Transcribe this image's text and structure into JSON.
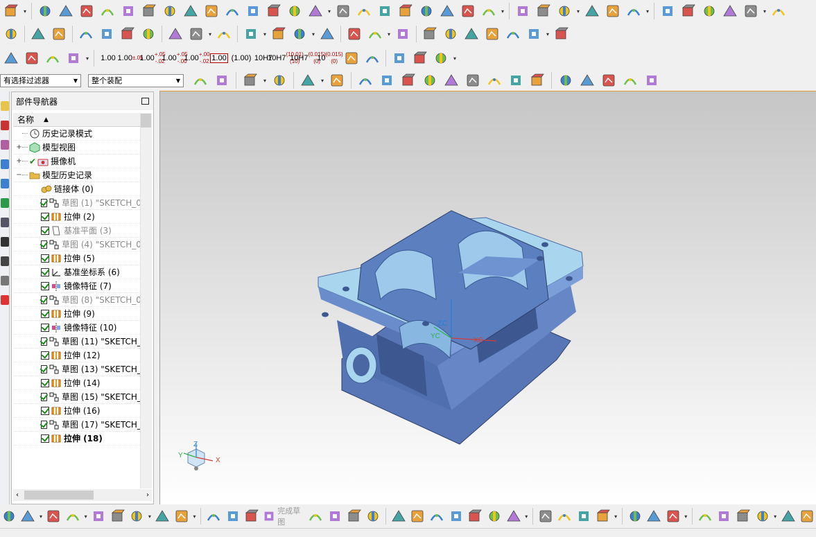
{
  "filter": {
    "selection_filter": "有选择过滤器",
    "scope": "整个装配"
  },
  "tolerance_buttons": [
    {
      "main": "1.00",
      "sub": ""
    },
    {
      "main": "1.00",
      "sub": "±.05"
    },
    {
      "main": "1.00",
      "sub": "+.05 -.02"
    },
    {
      "main": "1.00",
      "sub": "+.05 -.00"
    },
    {
      "main": "1.00",
      "sub": "+.00 -.02"
    },
    {
      "main": "1.00",
      "sub": "boxed"
    },
    {
      "main": "(1.00)",
      "sub": ""
    },
    {
      "main": "10H7",
      "sub": ""
    },
    {
      "main": "10H7",
      "sub": "(10.01) (10)"
    },
    {
      "main": "10H7",
      "sub": "(0.015) (0)"
    },
    {
      "main": "10",
      "sub": "(0.015) (0)"
    }
  ],
  "toolbar2_label": "10H7",
  "navigator": {
    "title": "部件导航器",
    "column_name": "名称",
    "items": [
      {
        "label": "历史记录模式",
        "depth": 0,
        "expander": "",
        "check": "none",
        "icon": "clock-icon",
        "style": ""
      },
      {
        "label": "模型视图",
        "depth": 0,
        "expander": "+",
        "check": "none",
        "icon": "model-view-icon",
        "style": ""
      },
      {
        "label": "摄像机",
        "depth": 0,
        "expander": "+",
        "check": "tick",
        "icon": "camera-icon",
        "style": ""
      },
      {
        "label": "模型历史记录",
        "depth": 0,
        "expander": "−",
        "check": "none",
        "icon": "folder-icon",
        "style": ""
      },
      {
        "label": "链接体 (0)",
        "depth": 1,
        "expander": "",
        "check": "none",
        "icon": "linked-body-icon",
        "style": ""
      },
      {
        "label": "草图 (1) \"SKETCH_0...",
        "depth": 1,
        "expander": "",
        "check": "on",
        "icon": "sketch-icon",
        "style": "grey"
      },
      {
        "label": "拉伸 (2)",
        "depth": 1,
        "expander": "",
        "check": "on",
        "icon": "extrude-icon",
        "style": ""
      },
      {
        "label": "基准平面 (3)",
        "depth": 1,
        "expander": "",
        "check": "on",
        "icon": "datum-plane-icon",
        "style": "grey"
      },
      {
        "label": "草图 (4) \"SKETCH_0...",
        "depth": 1,
        "expander": "",
        "check": "on",
        "icon": "sketch-icon",
        "style": "grey"
      },
      {
        "label": "拉伸 (5)",
        "depth": 1,
        "expander": "",
        "check": "on",
        "icon": "extrude-icon",
        "style": ""
      },
      {
        "label": "基准坐标系 (6)",
        "depth": 1,
        "expander": "",
        "check": "on",
        "icon": "datum-csys-icon",
        "style": ""
      },
      {
        "label": "镜像特征 (7)",
        "depth": 1,
        "expander": "",
        "check": "on",
        "icon": "mirror-icon",
        "style": ""
      },
      {
        "label": "草图 (8) \"SKETCH_0...",
        "depth": 1,
        "expander": "",
        "check": "on",
        "icon": "sketch-icon",
        "style": "grey"
      },
      {
        "label": "拉伸 (9)",
        "depth": 1,
        "expander": "",
        "check": "on",
        "icon": "extrude-icon",
        "style": ""
      },
      {
        "label": "镜像特征 (10)",
        "depth": 1,
        "expander": "",
        "check": "on",
        "icon": "mirror-icon",
        "style": ""
      },
      {
        "label": "草图 (11) \"SKETCH_...",
        "depth": 1,
        "expander": "",
        "check": "on",
        "icon": "sketch-icon",
        "style": ""
      },
      {
        "label": "拉伸 (12)",
        "depth": 1,
        "expander": "",
        "check": "on",
        "icon": "extrude-icon",
        "style": ""
      },
      {
        "label": "草图 (13) \"SKETCH_...",
        "depth": 1,
        "expander": "",
        "check": "on",
        "icon": "sketch-icon",
        "style": ""
      },
      {
        "label": "拉伸 (14)",
        "depth": 1,
        "expander": "",
        "check": "on",
        "icon": "extrude-icon",
        "style": ""
      },
      {
        "label": "草图 (15) \"SKETCH_...",
        "depth": 1,
        "expander": "",
        "check": "on",
        "icon": "sketch-icon",
        "style": ""
      },
      {
        "label": "拉伸 (16)",
        "depth": 1,
        "expander": "",
        "check": "on",
        "icon": "extrude-icon",
        "style": ""
      },
      {
        "label": "草图 (17) \"SKETCH_...",
        "depth": 1,
        "expander": "",
        "check": "on",
        "icon": "sketch-icon",
        "style": ""
      },
      {
        "label": "拉伸 (18)",
        "depth": 1,
        "expander": "",
        "check": "on",
        "icon": "extrude-icon",
        "style": "bold"
      }
    ]
  },
  "viewport": {
    "csys_labels": {
      "zc": "ZC",
      "yc": "YC",
      "xc": "XC"
    },
    "triad_labels": {
      "z": "Z",
      "y": "Y",
      "x": "X"
    }
  },
  "bottom_toolbar": {
    "finish_sketch_label": "完成草图"
  },
  "colors": {
    "model_face": "#5b7fbf",
    "model_top": "#a9d6ee",
    "viewport_top": "#c6c6c6",
    "viewport_bottom": "#ffffff",
    "check_green": "#1a8a1a"
  }
}
